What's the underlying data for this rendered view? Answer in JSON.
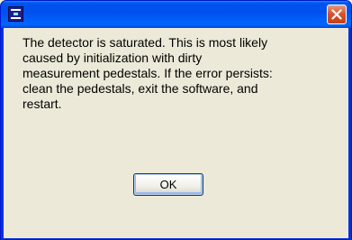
{
  "dialog": {
    "icon": "app-icon",
    "close_icon": "close-icon",
    "message": "The detector is saturated.  This is most likely\ncaused by initialization with dirty\nmeasurement pedestals. If the error persists:\nclean the pedestals, exit the software, and\nrestart.",
    "ok_label": "OK"
  },
  "colors": {
    "titlebar": "#0054e3",
    "close_button": "#d7562f",
    "client_background": "#ece9d8"
  }
}
